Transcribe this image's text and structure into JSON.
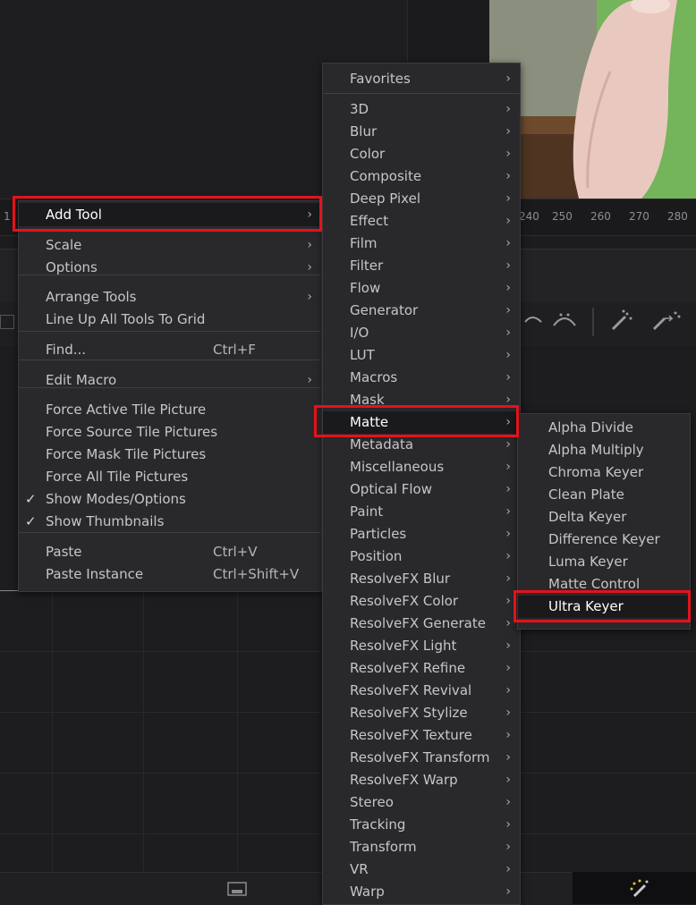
{
  "ruler": {
    "ticks": [
      "1",
      "240",
      "250",
      "260",
      "270",
      "280"
    ]
  },
  "context_menu": {
    "items": [
      {
        "label": "Add Tool",
        "submenu": true,
        "highlighted": true
      },
      {
        "label": "Scale",
        "submenu": true
      },
      {
        "label": "Options",
        "submenu": true
      },
      {
        "label": "Arrange Tools",
        "submenu": true
      },
      {
        "label": "Line Up All Tools To Grid"
      },
      {
        "label": "Find...",
        "shortcut": "Ctrl+F"
      },
      {
        "label": "Edit Macro",
        "submenu": true
      },
      {
        "label": "Force Active Tile Picture"
      },
      {
        "label": "Force Source Tile Pictures"
      },
      {
        "label": "Force Mask Tile Pictures"
      },
      {
        "label": "Force All Tile Pictures"
      },
      {
        "label": "Show Modes/Options",
        "checked": true
      },
      {
        "label": "Show Thumbnails",
        "checked": true
      },
      {
        "label": "Paste",
        "shortcut": "Ctrl+V"
      },
      {
        "label": "Paste Instance",
        "shortcut": "Ctrl+Shift+V"
      }
    ],
    "check_glyph": "✓"
  },
  "add_tool_menu": {
    "items": [
      "Favorites",
      "3D",
      "Blur",
      "Color",
      "Composite",
      "Deep Pixel",
      "Effect",
      "Film",
      "Filter",
      "Flow",
      "Generator",
      "I/O",
      "LUT",
      "Macros",
      "Mask",
      "Matte",
      "Metadata",
      "Miscellaneous",
      "Optical Flow",
      "Paint",
      "Particles",
      "Position",
      "ResolveFX Blur",
      "ResolveFX Color",
      "ResolveFX Generate",
      "ResolveFX Light",
      "ResolveFX Refine",
      "ResolveFX Revival",
      "ResolveFX Stylize",
      "ResolveFX Texture",
      "ResolveFX Transform",
      "ResolveFX Warp",
      "Stereo",
      "Tracking",
      "Transform",
      "VR",
      "Warp"
    ],
    "highlighted": "Matte"
  },
  "matte_menu": {
    "items": [
      "Alpha Divide",
      "Alpha Multiply",
      "Chroma Keyer",
      "Clean Plate",
      "Delta Keyer",
      "Difference Keyer",
      "Luma Keyer",
      "Matte Control",
      "Ultra Keyer"
    ],
    "highlighted": "Ultra Keyer"
  },
  "colors": {
    "annotation_red": "#e4121c",
    "menu_bg": "#29292c",
    "highlight_bg": "#1a1a1c",
    "green_screen": "#6fb356"
  },
  "icons": {
    "submenu_arrow": "›"
  }
}
